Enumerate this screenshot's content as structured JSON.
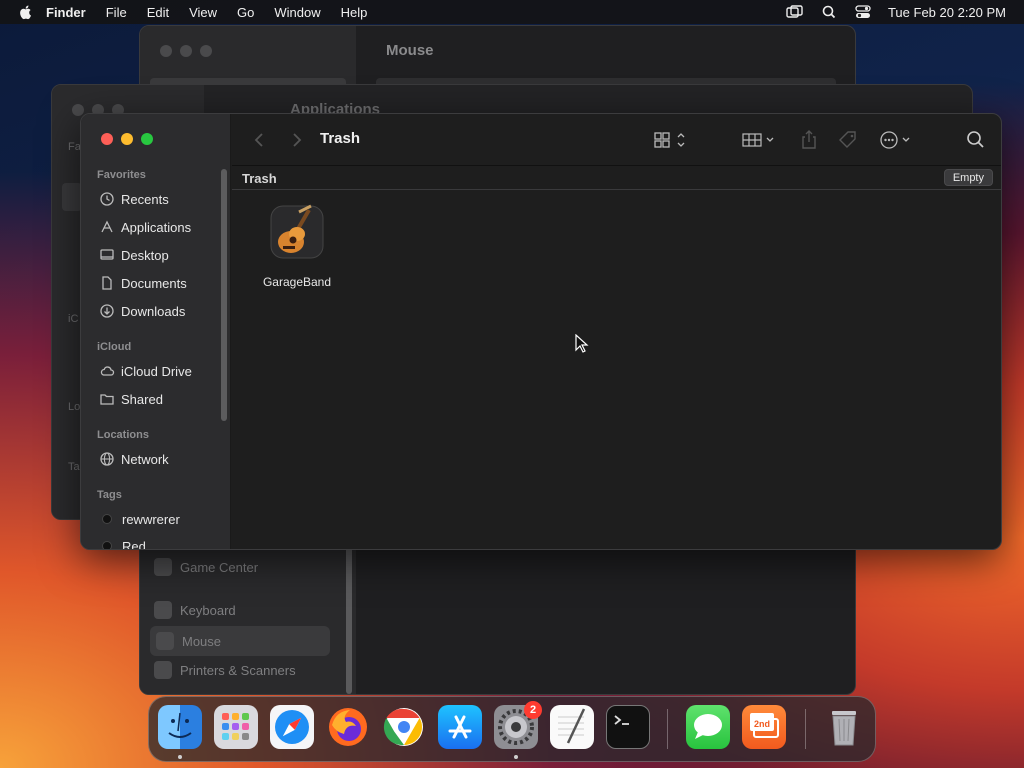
{
  "menubar": {
    "app_name": "Finder",
    "items": [
      "File",
      "Edit",
      "View",
      "Go",
      "Window",
      "Help"
    ],
    "clock": "Tue Feb 20  2:20 PM"
  },
  "back_window": {
    "title": "Mouse",
    "sidebar_items": [
      {
        "label": "Game Center",
        "selected": false
      },
      {
        "label": "Keyboard",
        "selected": false
      },
      {
        "label": "Mouse",
        "selected": true
      },
      {
        "label": "Printers & Scanners",
        "selected": false
      }
    ]
  },
  "mid_window": {
    "title": "Applications",
    "fragments": [
      "Fa",
      "iC",
      "Lo",
      "Ta"
    ]
  },
  "finder": {
    "title": "Trash",
    "path_title": "Trash",
    "empty_label": "Empty",
    "sidebar": {
      "favorites_label": "Favorites",
      "favorites": [
        {
          "label": "Recents",
          "icon": "clock-icon"
        },
        {
          "label": "Applications",
          "icon": "applications-icon"
        },
        {
          "label": "Desktop",
          "icon": "desktop-icon"
        },
        {
          "label": "Documents",
          "icon": "document-icon"
        },
        {
          "label": "Downloads",
          "icon": "download-icon"
        }
      ],
      "icloud_label": "iCloud",
      "icloud": [
        {
          "label": "iCloud Drive",
          "icon": "cloud-icon"
        },
        {
          "label": "Shared",
          "icon": "shared-folder-icon"
        }
      ],
      "locations_label": "Locations",
      "locations": [
        {
          "label": "Network",
          "icon": "globe-icon"
        }
      ],
      "tags_label": "Tags",
      "tags": [
        {
          "label": "rewwrerer",
          "color": "#111111"
        },
        {
          "label": "Red",
          "color": "#111111"
        }
      ]
    },
    "files": [
      {
        "name": "GarageBand",
        "icon": "garageband-icon"
      }
    ]
  },
  "dock": {
    "apps": [
      {
        "name": "finder-dock-icon",
        "running": true
      },
      {
        "name": "launchpad-dock-icon",
        "running": false
      },
      {
        "name": "safari-dock-icon",
        "running": false
      },
      {
        "name": "firefox-dock-icon",
        "running": false
      },
      {
        "name": "chrome-dock-icon",
        "running": false
      },
      {
        "name": "app-store-dock-icon",
        "running": false
      },
      {
        "name": "system-settings-dock-icon",
        "running": true,
        "badge": "2"
      },
      {
        "name": "textedit-dock-icon",
        "running": false
      },
      {
        "name": "terminal-dock-icon",
        "running": false
      },
      {
        "name": "messages-dock-icon",
        "running": false
      },
      {
        "name": "2nd-dock-icon",
        "running": false
      },
      {
        "name": "trash-dock-icon",
        "running": false
      }
    ],
    "badge_count": "2",
    "second_app_label": "2nd"
  }
}
